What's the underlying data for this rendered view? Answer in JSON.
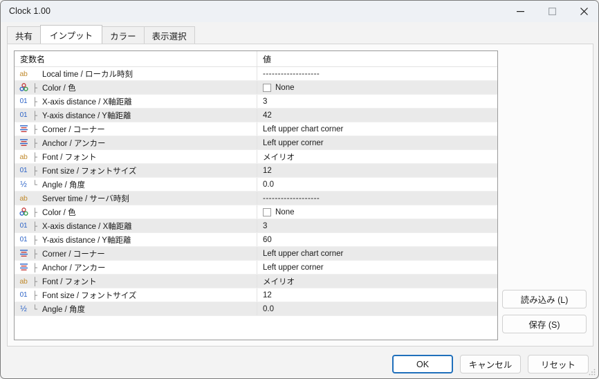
{
  "window": {
    "title": "Clock 1.00",
    "controls": {
      "minimize": "minimize-icon",
      "maximize": "maximize-icon",
      "close": "close-icon"
    }
  },
  "tabs": [
    {
      "label": "共有",
      "selected": false
    },
    {
      "label": "インプット",
      "selected": true
    },
    {
      "label": "カラー",
      "selected": false
    },
    {
      "label": "表示選択",
      "selected": false
    }
  ],
  "grid": {
    "headers": {
      "name": "変数名",
      "value": "値"
    },
    "rows": [
      {
        "icon": "ab",
        "tree": "",
        "label": "Local time / ローカル時刻",
        "value": "-------------------",
        "value_type": "dashes",
        "striped": false
      },
      {
        "icon": "color",
        "tree": "├",
        "label": "Color / 色",
        "value": "None",
        "value_type": "swatch",
        "swatch_color": "#ffffff",
        "striped": true
      },
      {
        "icon": "01",
        "tree": "├",
        "label": "X-axis distance / X軸距離",
        "value": "3",
        "value_type": "text",
        "striped": false
      },
      {
        "icon": "01",
        "tree": "├",
        "label": "Y-axis distance / Y軸距離",
        "value": "42",
        "value_type": "text",
        "striped": true
      },
      {
        "icon": "align",
        "tree": "├",
        "label": "Corner / コーナー",
        "value": "Left upper chart corner",
        "value_type": "text",
        "striped": false
      },
      {
        "icon": "align",
        "tree": "├",
        "label": "Anchor / アンカー",
        "value": "Left upper corner",
        "value_type": "text",
        "striped": true
      },
      {
        "icon": "ab",
        "tree": "├",
        "label": "Font / フォント",
        "value": "メイリオ",
        "value_type": "text",
        "striped": false
      },
      {
        "icon": "01",
        "tree": "├",
        "label": "Font size / フォントサイズ",
        "value": "12",
        "value_type": "text",
        "striped": true
      },
      {
        "icon": "half",
        "tree": "└",
        "label": "Angle / 角度",
        "value": "0.0",
        "value_type": "text",
        "striped": false
      },
      {
        "icon": "ab",
        "tree": "",
        "label": "Server time / サーバ時刻",
        "value": "-------------------",
        "value_type": "dashes",
        "striped": true
      },
      {
        "icon": "color",
        "tree": "├",
        "label": "Color / 色",
        "value": "None",
        "value_type": "swatch",
        "swatch_color": "#ffffff",
        "striped": false
      },
      {
        "icon": "01",
        "tree": "├",
        "label": "X-axis distance / X軸距離",
        "value": "3",
        "value_type": "text",
        "striped": true
      },
      {
        "icon": "01",
        "tree": "├",
        "label": "Y-axis distance / Y軸距離",
        "value": "60",
        "value_type": "text",
        "striped": false
      },
      {
        "icon": "align",
        "tree": "├",
        "label": "Corner / コーナー",
        "value": "Left upper chart corner",
        "value_type": "text",
        "striped": true
      },
      {
        "icon": "align",
        "tree": "├",
        "label": "Anchor / アンカー",
        "value": "Left upper corner",
        "value_type": "text",
        "striped": false
      },
      {
        "icon": "ab",
        "tree": "├",
        "label": "Font / フォント",
        "value": "メイリオ",
        "value_type": "text",
        "striped": true
      },
      {
        "icon": "01",
        "tree": "├",
        "label": "Font size / フォントサイズ",
        "value": "12",
        "value_type": "text",
        "striped": false
      },
      {
        "icon": "half",
        "tree": "└",
        "label": "Angle / 角度",
        "value": "0.0",
        "value_type": "text",
        "striped": true
      }
    ]
  },
  "side_buttons": [
    {
      "label": "読み込み (L)",
      "accel": "L"
    },
    {
      "label": "保存 (S)",
      "accel": "S"
    }
  ],
  "bottom_buttons": [
    {
      "label": "OK",
      "default": true
    },
    {
      "label": "キャンセル",
      "default": false
    },
    {
      "label": "リセット",
      "default": false
    }
  ],
  "colors": {
    "accent": "#1f6fbb",
    "icon_text": "#c08a2e",
    "icon_number": "#2b62c6",
    "row_stripe": "#eaeaea",
    "titlebar": "#eef1f5"
  }
}
